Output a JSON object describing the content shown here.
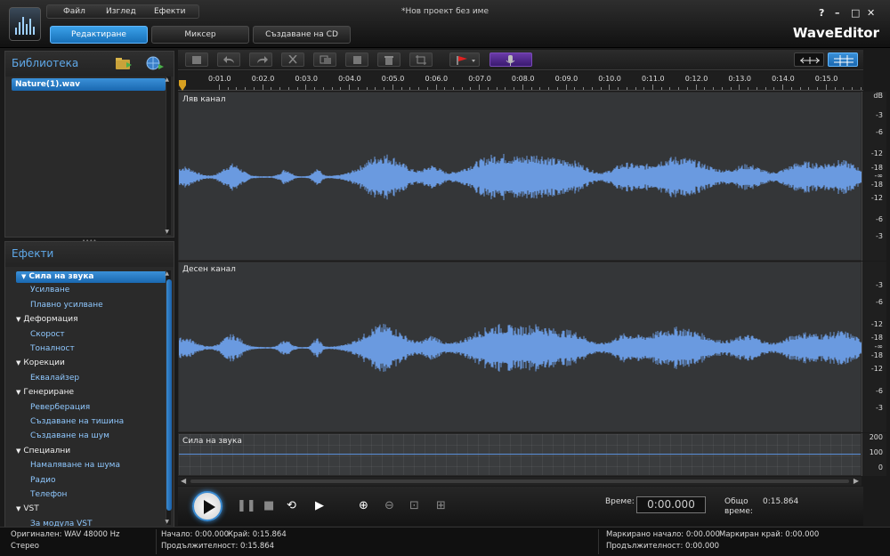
{
  "window": {
    "title": "*Нов проект без име",
    "brand": "WaveEditor"
  },
  "menu": {
    "file": "Файл",
    "view": "Изглед",
    "effects": "Ефекти"
  },
  "window_controls": {
    "help": "?",
    "minimize": "–",
    "maximize": "□",
    "close": "✕"
  },
  "mode_tabs": {
    "edit": "Редактиране",
    "mixer": "Миксер",
    "cd": "Създаване на CD"
  },
  "library": {
    "title": "Библиотека",
    "items": [
      "Nature(1).wav"
    ]
  },
  "effects": {
    "title": "Ефекти",
    "tree": [
      {
        "type": "cat",
        "label": "Сила на звука",
        "selected": true
      },
      {
        "type": "item",
        "label": "Усилване"
      },
      {
        "type": "item",
        "label": "Плавно усилване"
      },
      {
        "type": "cat",
        "label": "Деформация"
      },
      {
        "type": "item",
        "label": "Скорост"
      },
      {
        "type": "item",
        "label": "Тоналност"
      },
      {
        "type": "cat",
        "label": "Корекции"
      },
      {
        "type": "item",
        "label": "Еквалайзер"
      },
      {
        "type": "cat",
        "label": "Генериране"
      },
      {
        "type": "item",
        "label": "Реверберация"
      },
      {
        "type": "item",
        "label": "Създаване на тишина"
      },
      {
        "type": "item",
        "label": "Създаване на шум"
      },
      {
        "type": "cat",
        "label": "Специални"
      },
      {
        "type": "item",
        "label": "Намаляване на шума"
      },
      {
        "type": "item",
        "label": "Радио"
      },
      {
        "type": "item",
        "label": "Телефон"
      },
      {
        "type": "cat",
        "label": "VST"
      },
      {
        "type": "item",
        "label": "За модула VST"
      }
    ]
  },
  "ruler": {
    "ticks": [
      "0:01.0",
      "0:02.0",
      "0:03.0",
      "0:04.0",
      "0:05.0",
      "0:06.0",
      "0:07.0",
      "0:08.0",
      "0:09.0",
      "0:10.0",
      "0:11.0",
      "0:12.0",
      "0:13.0",
      "0:14.0",
      "0:15.0"
    ]
  },
  "channels": {
    "left": "Ляв канал",
    "right": "Десен канал",
    "volume": "Сила на звука"
  },
  "db_scale": {
    "unit": "dB",
    "marks": [
      "-3",
      "-6",
      "-12",
      "-18",
      "-∞",
      "-18",
      "-12",
      "-6",
      "-3"
    ]
  },
  "volume_scale": [
    "200",
    "100",
    "0"
  ],
  "transport": {
    "time_label": "Време:",
    "time_value": "0:00.000",
    "total_label_1": "Общо",
    "total_label_2": "време:",
    "total_value": "0:15.864"
  },
  "status": {
    "original": "Оригинален: WAV  48000 Hz",
    "channels": "Стерео",
    "start": "Начало: 0:00.000",
    "end": "Край: 0:15.864",
    "duration": "Продължителност: 0:15.864",
    "mark_start": "Маркирано начало: 0:00.000",
    "mark_end": "Маркиран край: 0:00.000",
    "mark_duration": "Продължителност: 0:00.000"
  },
  "colors": {
    "accent": "#2a80d0",
    "waveform": "#6a9ae0",
    "effect_item": "#8fc8ff",
    "panel_title": "#5fa8e8"
  }
}
